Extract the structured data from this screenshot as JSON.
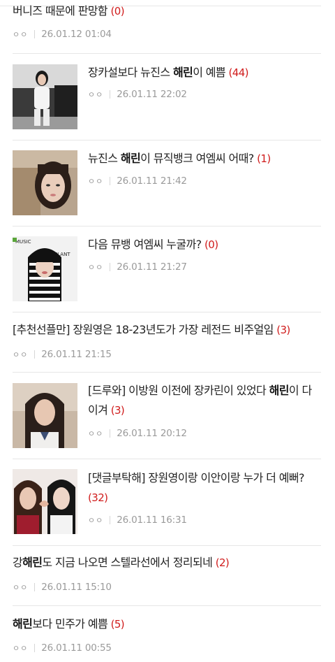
{
  "posts": [
    {
      "parts": [
        {
          "t": "버니즈 때문에 판망함 "
        }
      ],
      "count": "(0)",
      "author": "ㅇㅇ",
      "date": "26.01.12 01:04"
    },
    {
      "parts": [
        {
          "t": "장카설보다 뉴진스 "
        },
        {
          "t": "해린",
          "b": true
        },
        {
          "t": "이 예쁨 "
        }
      ],
      "count": "(44)",
      "author": "ㅇㅇ",
      "date": "26.01.11 22:02"
    },
    {
      "parts": [
        {
          "t": "뉴진스 "
        },
        {
          "t": "해린",
          "b": true
        },
        {
          "t": "이 뮤직뱅크 여엠씨 어때? "
        }
      ],
      "count": "(1)",
      "author": "ㅇㅇ",
      "date": "26.01.11 21:42"
    },
    {
      "parts": [
        {
          "t": "다음 뮤뱅 여엠씨 누굴까? "
        }
      ],
      "count": "(0)",
      "author": "ㅇㅇ",
      "date": "26.01.11 21:27"
    },
    {
      "parts": [
        {
          "t": "[추천선플만] 장원영은 18-23년도가 가장 레전드 비주얼임 "
        }
      ],
      "count": "(3)",
      "author": "ㅇㅇ",
      "date": "26.01.11 21:15"
    },
    {
      "parts": [
        {
          "t": "[드루와] 이방원 이전에 장카린이 있었다 "
        },
        {
          "t": "해린",
          "b": true
        },
        {
          "t": "이 다이겨 "
        }
      ],
      "count": "(3)",
      "author": "ㅇㅇ",
      "date": "26.01.11 20:12"
    },
    {
      "parts": [
        {
          "t": "[댓글부탁해] 장원영이랑 이안이랑 누가 더 예뻐? "
        }
      ],
      "count": "(32)",
      "author": "ㅇㅇ",
      "date": "26.01.11 16:31"
    },
    {
      "parts": [
        {
          "t": "강"
        },
        {
          "t": "해린",
          "b": true
        },
        {
          "t": "도 지금 나오면 스텔라선에서 정리되네 "
        }
      ],
      "count": "(2)",
      "author": "ㅇㅇ",
      "date": "26.01.11 15:10"
    },
    {
      "parts": [
        {
          "t": "해린",
          "b": true
        },
        {
          "t": "보다 민주가 예쁨 "
        }
      ],
      "count": "(5)",
      "author": "ㅇㅇ",
      "date": "26.01.11 00:55"
    }
  ],
  "colors": {
    "count": "#d01c1c",
    "meta": "#9a9a9a",
    "divider": "#e6e6e6"
  }
}
